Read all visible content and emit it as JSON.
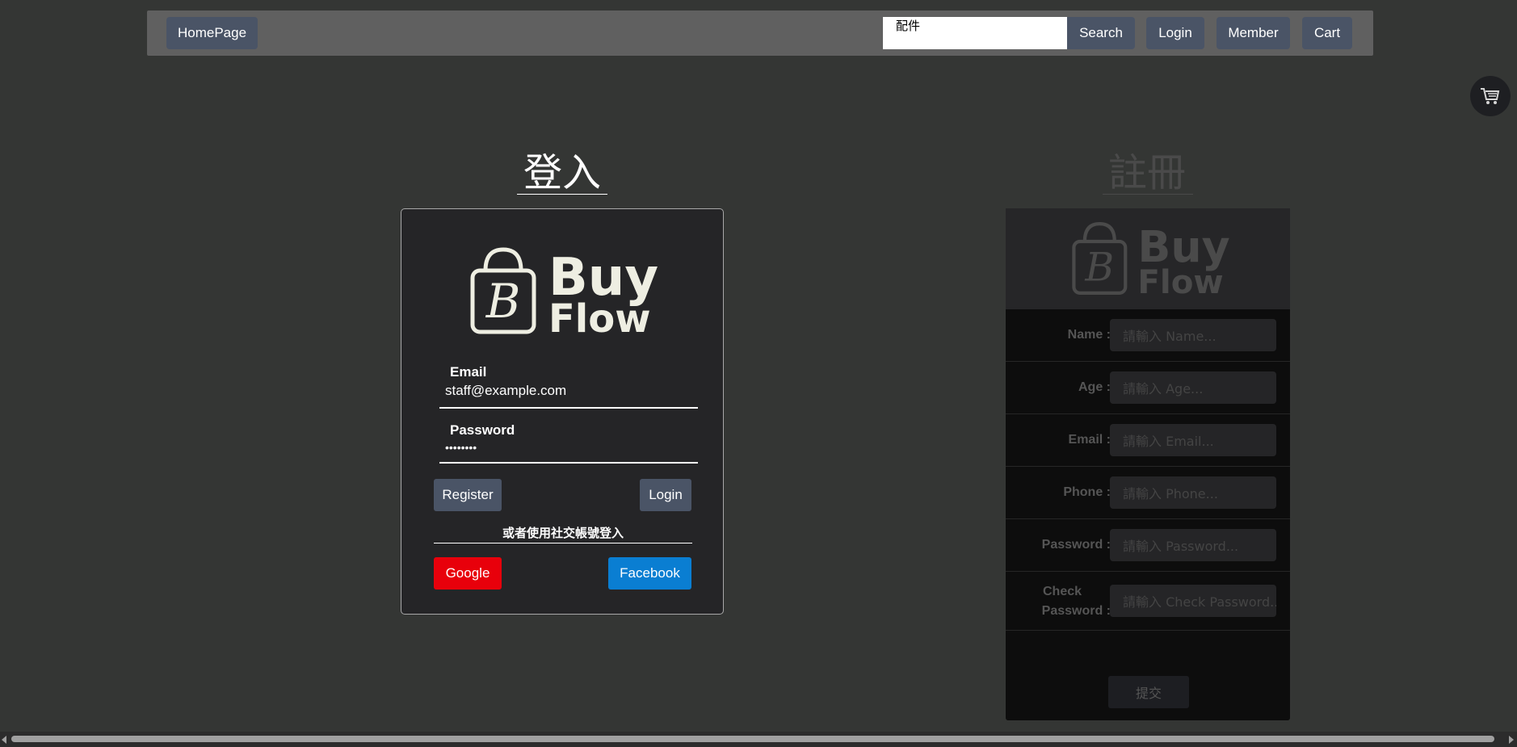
{
  "navbar": {
    "home_label": "HomePage",
    "search_value": "配件",
    "search_label": "Search",
    "login_label": "Login",
    "member_label": "Member",
    "cart_label": "Cart"
  },
  "float_cart": {
    "icon": "shopping-cart-icon"
  },
  "login": {
    "title": "登入",
    "logo_line1": "Buy",
    "logo_line2": "Flow",
    "email_label": "Email",
    "email_value": "staff@example.com",
    "password_label": "Password",
    "password_value": "••••••••",
    "register_label": "Register",
    "login_label": "Login",
    "social_text": "或者使用社交帳號登入",
    "google_label": "Google",
    "facebook_label": "Facebook"
  },
  "register": {
    "title": "註冊",
    "logo_line1": "Buy",
    "logo_line2": "Flow",
    "fields": [
      {
        "label": "Name :",
        "placeholder": "請輸入 Name..."
      },
      {
        "label": "Age :",
        "placeholder": "請輸入 Age..."
      },
      {
        "label": "Email :",
        "placeholder": "請輸入 Email..."
      },
      {
        "label": "Phone :",
        "placeholder": "請輸入 Phone..."
      },
      {
        "label": "Password :",
        "placeholder": "請輸入 Password..."
      },
      {
        "label_line1": "Check",
        "label_line2": "Password :",
        "placeholder": "請輸入 Check Password..."
      }
    ],
    "submit_label": "提交"
  },
  "colors": {
    "background": "#343634",
    "navbar": "#606060",
    "button": "#4a5466",
    "google": "#e8000b",
    "facebook": "#0a7ed2",
    "logo": "#eeeee2"
  }
}
